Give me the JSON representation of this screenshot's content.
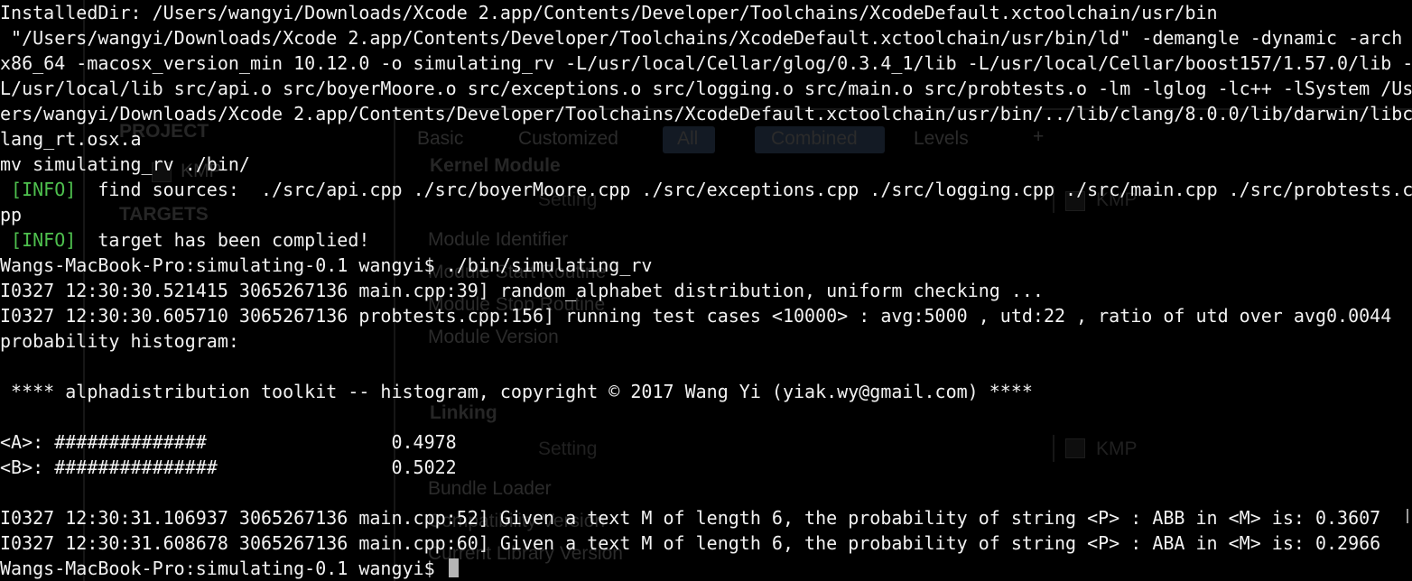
{
  "background_window": {
    "project_label": "PROJECT",
    "targets_label": "TARGETS",
    "project_item": "KMP",
    "tabs": [
      "Basic",
      "Customized",
      "All",
      "Combined",
      "Levels"
    ],
    "add_symbol": "+",
    "kernel_section": "Kernel Module",
    "linking_section": "Linking",
    "setting_header": "Setting",
    "target_column": "KMP",
    "rows_kernel": [
      "Module Identifier",
      "Module Start Routine",
      "Module Stop Routine",
      "Module Version"
    ],
    "rows_linking": [
      "Bundle Loader",
      "Compatibility Version",
      "Current Library Version"
    ]
  },
  "terminal": {
    "lines": [
      {
        "text": "InstalledDir: /Users/wangyi/Downloads/Xcode 2.app/Contents/Developer/Toolchains/XcodeDefault.xctoolchain/usr/bin"
      },
      {
        "text": " \"/Users/wangyi/Downloads/Xcode 2.app/Contents/Developer/Toolchains/XcodeDefault.xctoolchain/usr/bin/ld\" -demangle -dynamic -arch"
      },
      {
        "text": "x86_64 -macosx_version_min 10.12.0 -o simulating_rv -L/usr/local/Cellar/glog/0.3.4_1/lib -L/usr/local/Cellar/boost157/1.57.0/lib -"
      },
      {
        "text": "L/usr/local/lib src/api.o src/boyerMoore.o src/exceptions.o src/logging.o src/main.o src/probtests.o -lm -lglog -lc++ -lSystem /Us"
      },
      {
        "text": "ers/wangyi/Downloads/Xcode 2.app/Contents/Developer/Toolchains/XcodeDefault.xctoolchain/usr/bin/../lib/clang/8.0.0/lib/darwin/libc"
      },
      {
        "text": "lang_rt.osx.a"
      },
      {
        "text": "mv simulating_rv ./bin/"
      },
      {
        "tag": " [INFO]",
        "text": "  find sources:  ./src/api.cpp ./src/boyerMoore.cpp ./src/exceptions.cpp ./src/logging.cpp ./src/main.cpp ./src/probtests.c"
      },
      {
        "text": "pp"
      },
      {
        "tag": " [INFO]",
        "text": "  target has been complied!"
      },
      {
        "text": "Wangs-MacBook-Pro:simulating-0.1 wangyi$ ./bin/simulating_rv"
      },
      {
        "text": "I0327 12:30:30.521415 3065267136 main.cpp:39] random_alphabet distribution, uniform checking ..."
      },
      {
        "text": "I0327 12:30:30.605710 3065267136 probtests.cpp:156] running test cases <10000> : avg:5000 , utd:22 , ratio of utd over avg0.0044"
      },
      {
        "text": "probability histogram:"
      },
      {
        "text": ""
      },
      {
        "text": " **** alphadistribution toolkit -- histogram, copyright © 2017 Wang Yi (yiak.wy@gmail.com) ****"
      },
      {
        "text": ""
      },
      {
        "text": "<A>: ##############                 0.4978"
      },
      {
        "text": "<B>: ###############                0.5022"
      },
      {
        "text": ""
      },
      {
        "text": "I0327 12:30:31.106937 3065267136 main.cpp:52] Given a text M of length 6, the probability of string <P> : ABB in <M> is: 0.3607"
      },
      {
        "text": "I0327 12:30:31.608678 3065267136 main.cpp:60] Given a text M of length 6, the probability of string <P> : ABA in <M> is: 0.2966"
      },
      {
        "text": "Wangs-MacBook-Pro:simulating-0.1 wangyi$ ",
        "cursor": true
      }
    ]
  },
  "colors": {
    "background": "#000000",
    "text": "#f2f2f2",
    "info_tag": "#4ec04e",
    "cursor": "#b5b5b5"
  }
}
